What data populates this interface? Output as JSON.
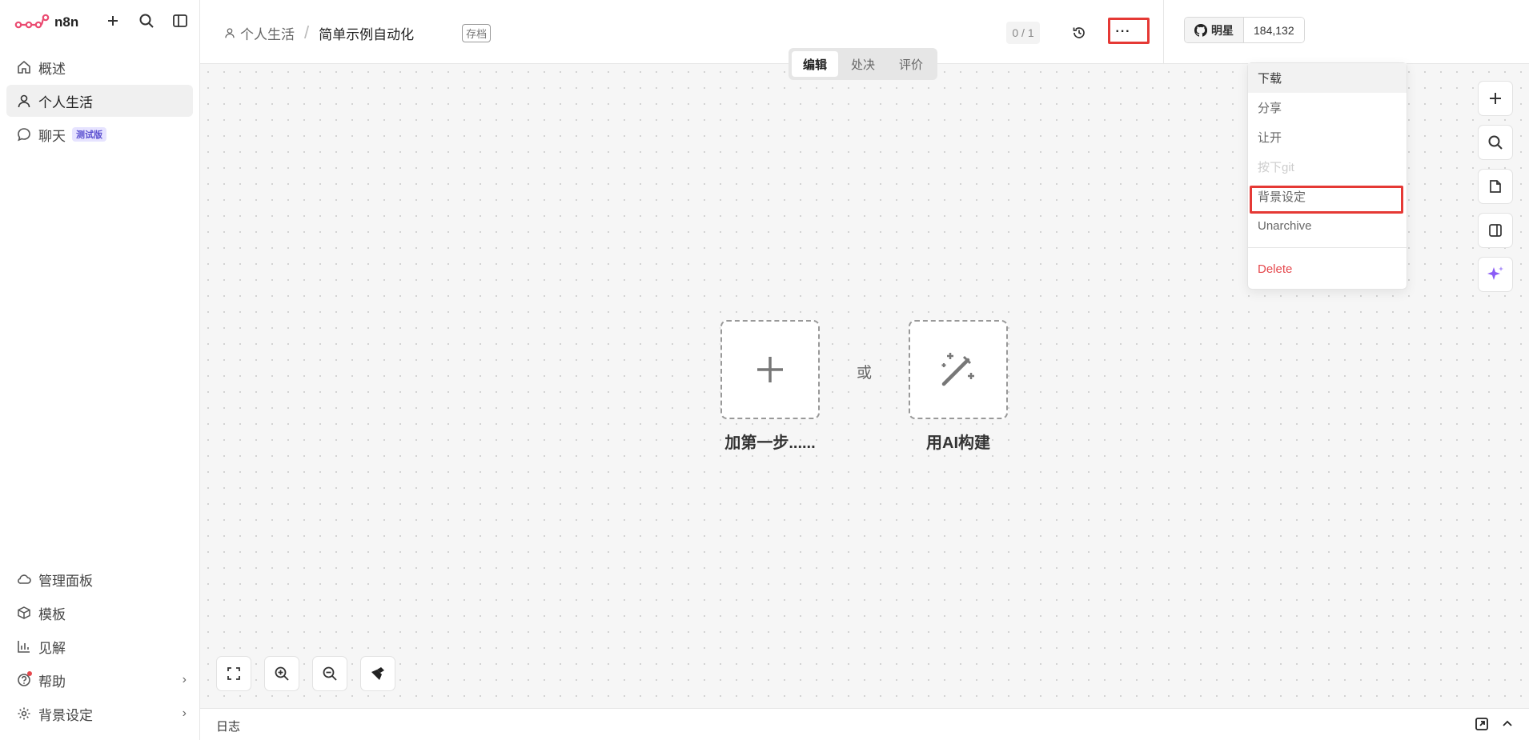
{
  "app": {
    "logo_text": "n8n"
  },
  "sidebar": {
    "nav": [
      {
        "label": "概述",
        "icon": "home-icon"
      },
      {
        "label": "个人生活",
        "icon": "user-icon"
      },
      {
        "label": "聊天",
        "icon": "chat-icon",
        "badge": "测试版"
      }
    ],
    "bottom": [
      {
        "label": "管理面板",
        "icon": "cloud-icon"
      },
      {
        "label": "模板",
        "icon": "box-icon"
      },
      {
        "label": "见解",
        "icon": "chart-icon"
      },
      {
        "label": "帮助",
        "icon": "help-icon"
      },
      {
        "label": "背景设定",
        "icon": "gear-icon"
      }
    ]
  },
  "header": {
    "project": "个人生活",
    "workflow_name": "简单示例自动化",
    "archived_tag": "存档",
    "counter": "0 / 1",
    "more": "···",
    "github": {
      "star_label": "明星",
      "count": "184,132"
    }
  },
  "mode_tabs": [
    "编辑",
    "处决",
    "评价"
  ],
  "canvas": {
    "add_step_label": "加第一步......",
    "or_label": "或",
    "ai_build_label": "用AI构建"
  },
  "menu": {
    "items": [
      "下载",
      "分享",
      "让开",
      "按下git",
      "背景设定",
      "Unarchive"
    ],
    "delete": "Delete"
  },
  "footer": {
    "log_label": "日志"
  },
  "colors": {
    "accent_red": "#e53935",
    "brand": "#ea4b71",
    "ai_purple": "#8b5cf6"
  }
}
